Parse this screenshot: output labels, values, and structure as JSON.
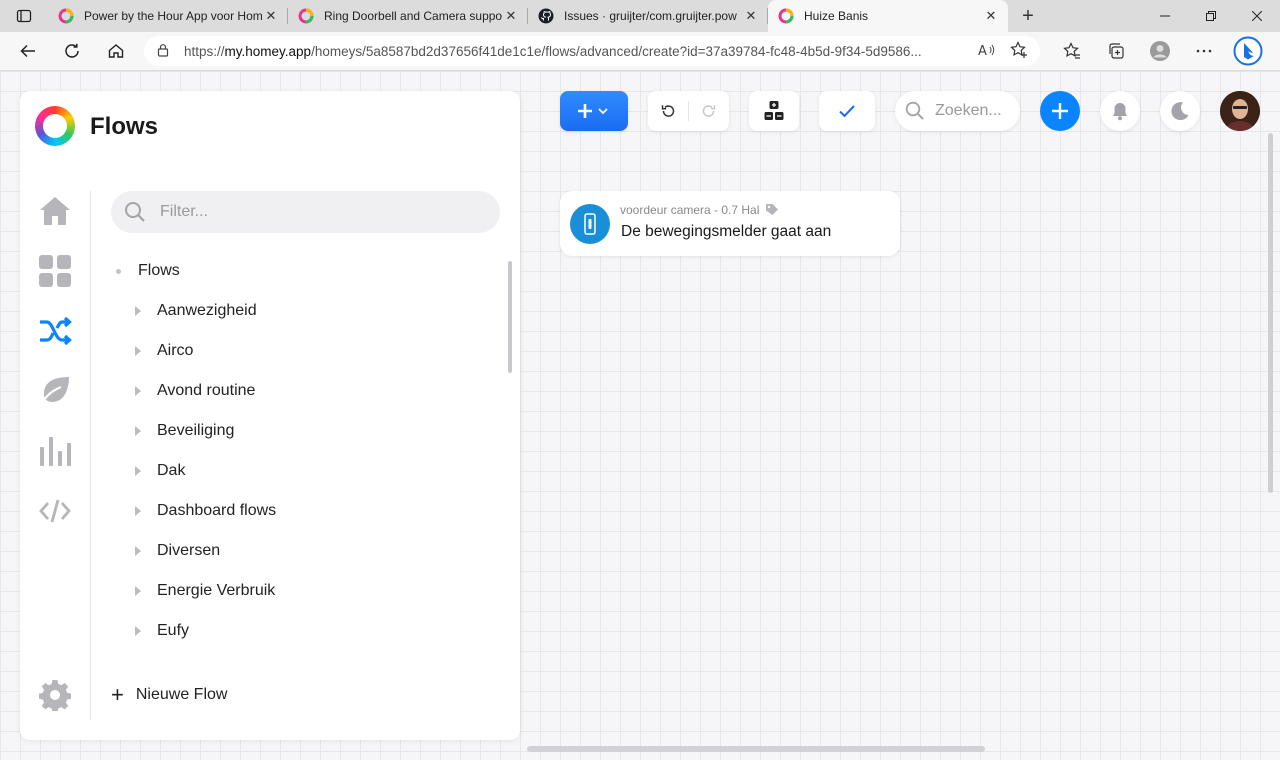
{
  "browser": {
    "tabs": [
      {
        "title": "Power by the Hour App voor Hom",
        "icon": "homey-icon",
        "active": false
      },
      {
        "title": "Ring Doorbell and Camera suppo",
        "icon": "homey-icon",
        "active": false
      },
      {
        "title": "Issues · gruijter/com.gruijter.pow",
        "icon": "github-icon",
        "active": false
      },
      {
        "title": "Huize Banis",
        "icon": "homey-icon",
        "active": true
      }
    ],
    "url_prefix": "https://",
    "url_host": "my.homey.app",
    "url_path": "/homeys/5a8587bd2d37656f41de1c1e/flows/advanced/create?id=37a39784-fc48-4b5d-9f34-5d9586..."
  },
  "sidebar": {
    "title": "Flows",
    "filter_placeholder": "Filter...",
    "tree_root": "Flows",
    "folders": [
      "Aanwezigheid",
      "Airco",
      "Avond routine",
      "Beveiliging",
      "Dak",
      "Dashboard flows",
      "Diversen",
      "Energie Verbruik",
      "Eufy"
    ],
    "new_flow_label": "Nieuwe Flow",
    "nav_icons": [
      "home-icon",
      "dashboard-icon",
      "flows-icon",
      "energy-leaf-icon",
      "insights-icon",
      "code-icon"
    ]
  },
  "toolbar": {
    "search_placeholder": "Zoeken..."
  },
  "flow_card": {
    "device_label": "voordeur camera - 0.7 Hal",
    "trigger_text": "De bewegingsmelder gaat aan"
  },
  "colors": {
    "accent": "#1a6cf0",
    "active_nav": "#0a84ff",
    "card_icon": "#1a8fd8"
  }
}
